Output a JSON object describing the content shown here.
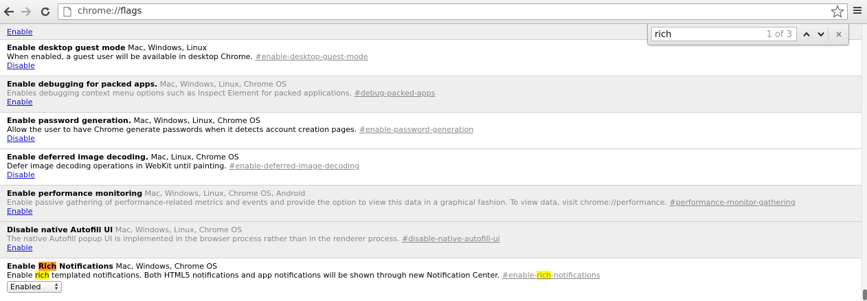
{
  "browser": {
    "url_scheme": "chrome://",
    "url_path": "flags",
    "icons": {
      "back": "back-arrow-icon",
      "forward": "forward-arrow-icon",
      "reload": "reload-icon",
      "page": "page-icon",
      "bookmark": "star-icon",
      "menu": "hamburger-menu-icon"
    }
  },
  "find_bar": {
    "query": "rich",
    "count": "1 of 3",
    "icons": {
      "prev": "chevron-up-icon",
      "next": "chevron-down-icon",
      "close": "close-icon"
    }
  },
  "flags": {
    "partial": {
      "action": "Enable"
    },
    "items": [
      {
        "name": "Enable desktop guest mode",
        "platforms": "Mac, Windows, Linux",
        "description": "When enabled, a guest user will be available in desktop Chrome.",
        "permalink": "#enable-desktop-guest-mode",
        "action": "Disable"
      },
      {
        "name": "Enable debugging for packed apps.",
        "platforms": "Mac, Windows, Linux, Chrome OS",
        "description": "Enables debugging context menu options such as Inspect Element for packed applications.",
        "permalink": "#debug-packed-apps",
        "action": "Enable"
      },
      {
        "name": "Enable password generation.",
        "platforms": "Mac, Windows, Linux, Chrome OS",
        "description": "Allow the user to have Chrome generate passwords when it detects account creation pages.",
        "permalink": "#enable-password-generation",
        "action": "Disable"
      },
      {
        "name": "Enable deferred image decoding.",
        "platforms": "Mac, Linux, Chrome OS",
        "description": "Defer image decoding operations in WebKit until painting.",
        "permalink": "#enable-deferred-image-decoding",
        "action": "Disable"
      },
      {
        "name": "Enable performance monitoring",
        "platforms": "Mac, Windows, Linux, Chrome OS, Android",
        "description": "Enable passive gathering of performance-related metrics and events and provide the option to view this data in a graphical fashion. To view data, visit chrome://performance.",
        "permalink": "#performance-monitor-gathering",
        "action": "Enable"
      },
      {
        "name": "Disable native Autofill UI",
        "platforms": "Mac, Windows, Linux, Chrome OS",
        "description": "The native Autofill popup UI is implemented in the browser process rather than in the renderer process.",
        "permalink": "#disable-native-autofill-ui",
        "action": "Enable"
      }
    ],
    "rich": {
      "name_prefix": "Enable ",
      "name_match": "Rich",
      "name_suffix": " Notifications",
      "platforms": "Mac, Windows, Chrome OS",
      "desc_prefix": "Enable ",
      "desc_match": "rich",
      "desc_suffix": " templated notifications. Both HTML5 notifications and app notifications will be shown through new Notification Center.",
      "permalink_prefix": "#enable-",
      "permalink_match": "rich",
      "permalink_suffix": "-notifications",
      "select_value": "Enabled",
      "select_options": [
        "Enabled"
      ]
    }
  },
  "colors": {
    "link": "#1111cc",
    "active_match": "#ff9632",
    "match": "#ffff00",
    "unavailable_bg": "#eeeeee"
  }
}
